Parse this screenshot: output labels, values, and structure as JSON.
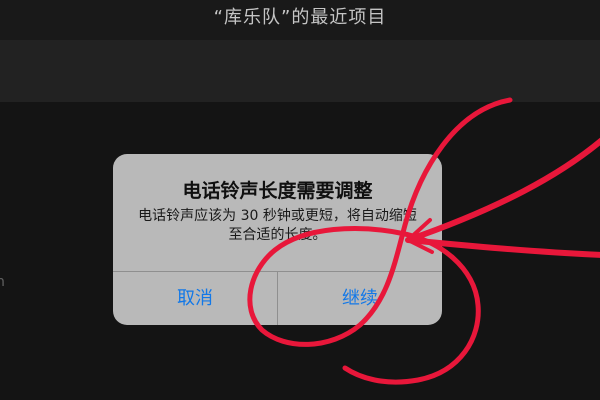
{
  "header": {
    "title": "“库乐队”的最近项目"
  },
  "side_text": "n",
  "alert": {
    "title": "电话铃声长度需要调整",
    "message": "电话铃声应该为 30 秒钟或更短，将自动缩短至合适的长度。",
    "buttons": {
      "cancel": "取消",
      "continue": "继续"
    },
    "button_color": "#1278e8"
  },
  "annotation": {
    "color": "#e8173a",
    "shapes": [
      "circle-around-continue-button",
      "arrow-pointing-at-continue"
    ]
  }
}
